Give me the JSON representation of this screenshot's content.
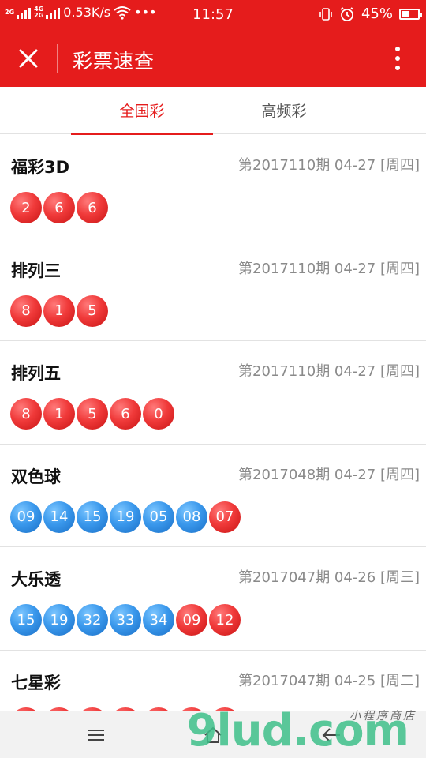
{
  "status_bar": {
    "net_tag_1": "2G",
    "net_tag_2": "4G",
    "net_tag_3": "2G",
    "speed": "0.53K/s",
    "dots": "•••",
    "time": "11:57",
    "battery": "45%",
    "battery_level": 0.45
  },
  "app_bar": {
    "title": "彩票速查"
  },
  "tabs": [
    {
      "label": "全国彩",
      "active": true
    },
    {
      "label": "高频彩",
      "active": false
    }
  ],
  "lotteries": [
    {
      "name": "福彩3D",
      "info": "第2017110期 04-27 [周四]",
      "balls": [
        {
          "n": "2",
          "c": "red"
        },
        {
          "n": "6",
          "c": "red"
        },
        {
          "n": "6",
          "c": "red"
        }
      ]
    },
    {
      "name": "排列三",
      "info": "第2017110期 04-27 [周四]",
      "balls": [
        {
          "n": "8",
          "c": "red"
        },
        {
          "n": "1",
          "c": "red"
        },
        {
          "n": "5",
          "c": "red"
        }
      ]
    },
    {
      "name": "排列五",
      "info": "第2017110期 04-27 [周四]",
      "balls": [
        {
          "n": "8",
          "c": "red"
        },
        {
          "n": "1",
          "c": "red"
        },
        {
          "n": "5",
          "c": "red"
        },
        {
          "n": "6",
          "c": "red"
        },
        {
          "n": "0",
          "c": "red"
        }
      ]
    },
    {
      "name": "双色球",
      "info": "第2017048期 04-27 [周四]",
      "balls": [
        {
          "n": "09",
          "c": "blue"
        },
        {
          "n": "14",
          "c": "blue"
        },
        {
          "n": "15",
          "c": "blue"
        },
        {
          "n": "19",
          "c": "blue"
        },
        {
          "n": "05",
          "c": "blue"
        },
        {
          "n": "08",
          "c": "blue"
        },
        {
          "n": "07",
          "c": "red"
        }
      ]
    },
    {
      "name": "大乐透",
      "info": "第2017047期 04-26 [周三]",
      "balls": [
        {
          "n": "15",
          "c": "blue"
        },
        {
          "n": "19",
          "c": "blue"
        },
        {
          "n": "32",
          "c": "blue"
        },
        {
          "n": "33",
          "c": "blue"
        },
        {
          "n": "34",
          "c": "blue"
        },
        {
          "n": "09",
          "c": "red"
        },
        {
          "n": "12",
          "c": "red"
        }
      ]
    },
    {
      "name": "七星彩",
      "info": "第2017047期 04-25 [周二]",
      "balls": [
        {
          "n": "",
          "c": "red"
        },
        {
          "n": "",
          "c": "red"
        },
        {
          "n": "",
          "c": "red"
        },
        {
          "n": "",
          "c": "red"
        },
        {
          "n": "",
          "c": "red"
        },
        {
          "n": "",
          "c": "red"
        },
        {
          "n": "",
          "c": "red"
        }
      ]
    }
  ],
  "watermark": {
    "text": "9lud.com",
    "sub": "小程序商店"
  },
  "colors": {
    "brand_red": "#e51c1c",
    "ball_red": "#f03a3a",
    "ball_blue": "#3a98ec",
    "info_gray": "#8a8a8a"
  },
  "icons": {
    "close": "close-icon",
    "more": "more-vertical-icon",
    "nav_menu": "menu-icon",
    "nav_home": "home-icon",
    "nav_back": "back-arrow-icon"
  }
}
